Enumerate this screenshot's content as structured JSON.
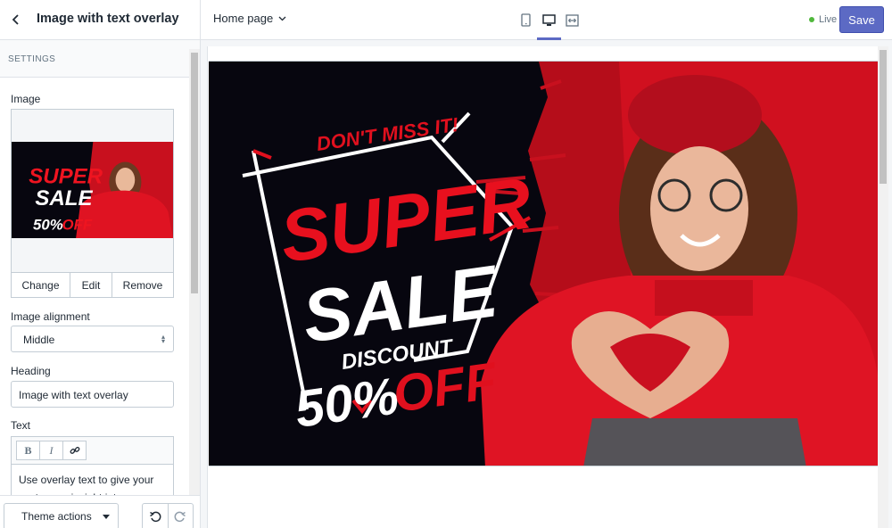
{
  "topbar": {
    "section_title": "Image with text overlay",
    "page_selector": "Home page",
    "live_label": "Live",
    "save_label": "Save"
  },
  "sidebar": {
    "settings_header": "SETTINGS",
    "image_label": "Image",
    "image_buttons": {
      "change": "Change",
      "edit": "Edit",
      "remove": "Remove"
    },
    "alignment_label": "Image alignment",
    "alignment_value": "Middle",
    "heading_label": "Heading",
    "heading_value": "Image with text overlay",
    "text_label": "Text",
    "text_toolbar": {
      "bold": "B",
      "italic": "I"
    },
    "text_value": "Use overlay text to give your customers insight into your",
    "theme_actions": "Theme actions"
  },
  "banner": {
    "line1": "DON'T MISS IT!",
    "line2": "SUPER",
    "line3": "SALE",
    "line4": "DISCOUNT",
    "line5a": "50%",
    "line5b": "OFF"
  },
  "colors": {
    "accent": "#5c6ac4",
    "promo_red": "#e0101e",
    "banner_dark": "#07060f",
    "live": "#50b83c"
  }
}
